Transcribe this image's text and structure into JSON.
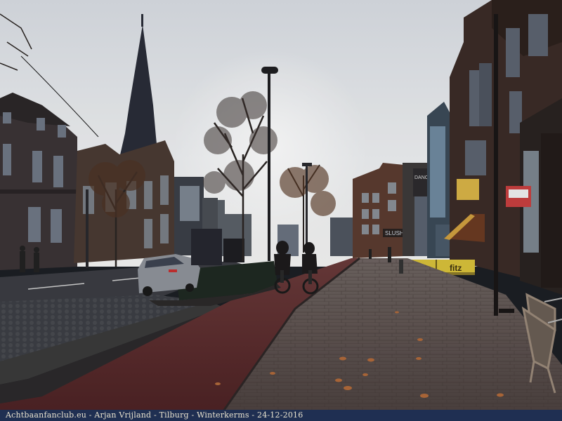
{
  "photo": {
    "scene": "street-photo",
    "sky_color": "#e8eaee",
    "road_color": "#3c3e44",
    "bike_lane_color": "#5a2a2c",
    "sidewalk_color": "#5b4f4d",
    "building_color": "#3a2d28"
  },
  "signs": {
    "fitz": "fitz",
    "slush": "SLUSH",
    "dance": "DANCE"
  },
  "caption": {
    "text": "Achtbaanfanclub.eu - Arjan Vrijland - Tilburg - Winterkerms - 24-12-2016"
  }
}
